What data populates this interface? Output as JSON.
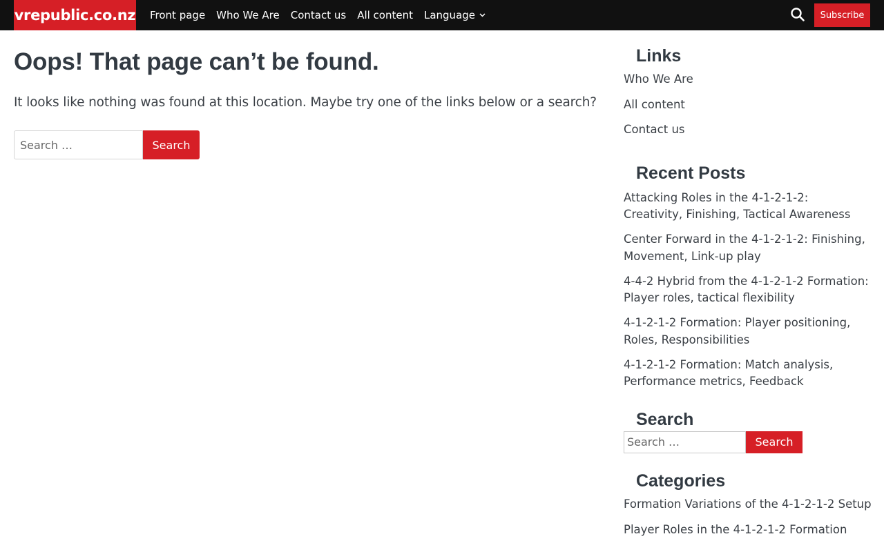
{
  "header": {
    "logo": "vrepublic.co.nz",
    "nav": [
      "Front page",
      "Who We Are",
      "Contact us",
      "All content"
    ],
    "language_label": "Language",
    "subscribe_label": "Subscribe",
    "search_icon": "search-icon"
  },
  "main": {
    "title": "Oops! That page can’t be found.",
    "text": "It looks like nothing was found at this location. Maybe try one of the links below or a search?",
    "search": {
      "placeholder": "Search …",
      "button": "Search"
    }
  },
  "sidebar": {
    "links": {
      "title": "Links",
      "items": [
        "Who We Are",
        "All content",
        "Contact us"
      ]
    },
    "recent_posts": {
      "title": "Recent Posts",
      "items": [
        "Attacking Roles in the 4-1-2-1-2: Creativity, Finishing, Tactical Awareness",
        "Center Forward in the 4-1-2-1-2: Finishing, Movement, Link-up play",
        "4-4-2 Hybrid from the 4-1-2-1-2 Formation: Player roles, tactical flexibility",
        "4-1-2-1-2 Formation: Player positioning, Roles, Responsibilities",
        "4-1-2-1-2 Formation: Match analysis, Performance metrics, Feedback"
      ]
    },
    "search": {
      "title": "Search",
      "placeholder": "Search …",
      "button": "Search"
    },
    "categories": {
      "title": "Categories",
      "items": [
        "Formation Variations of the 4-1-2-1-2 Setup",
        "Player Roles in the 4-1-2-1-2 Formation"
      ]
    }
  },
  "colors": {
    "accent": "#d61f26",
    "header_bg": "#111111",
    "text": "#323a42"
  }
}
